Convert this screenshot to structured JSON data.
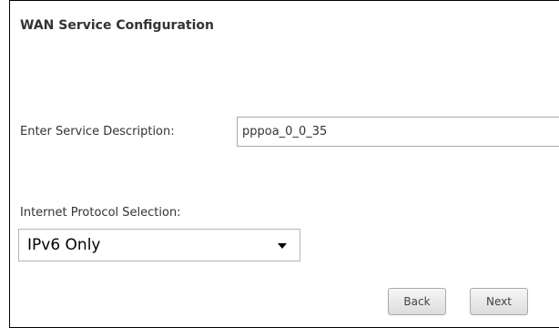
{
  "page": {
    "title": "WAN Service Configuration"
  },
  "service_description": {
    "label": "Enter Service Description:",
    "value": "pppoa_0_0_35"
  },
  "protocol": {
    "label": "Internet Protocol Selection:",
    "selected": "IPv6 Only",
    "icon": "chevron-down-icon"
  },
  "buttons": {
    "back": "Back",
    "next": "Next"
  },
  "colors": {
    "border": "#000000",
    "text": "#333333",
    "button_bg": "#e8e8e8"
  }
}
